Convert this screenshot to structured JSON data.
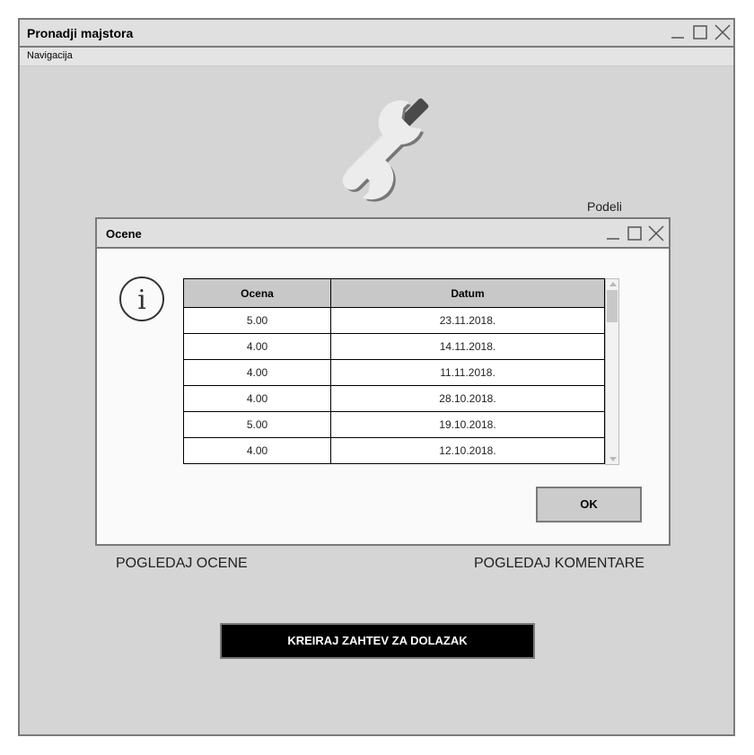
{
  "window": {
    "title": "Pronadji majstora",
    "controls": [
      "minimize-icon",
      "maximize-icon",
      "close-icon"
    ]
  },
  "menu": {
    "items": [
      "Navigacija"
    ]
  },
  "logo": {
    "icon": "wrench-screwdriver-icon"
  },
  "share_label": "Podeli",
  "dialog": {
    "title": "Ocene",
    "controls": [
      "minimize-icon",
      "maximize-icon",
      "close-icon"
    ],
    "icon": "info-icon",
    "table": {
      "headers": [
        "Ocena",
        "Datum"
      ],
      "rows": [
        [
          "5.00",
          "23.11.2018."
        ],
        [
          "4.00",
          "14.11.2018."
        ],
        [
          "4.00",
          "11.11.2018."
        ],
        [
          "4.00",
          "28.10.2018."
        ],
        [
          "5.00",
          "19.10.2018."
        ],
        [
          "4.00",
          "12.10.2018."
        ]
      ]
    },
    "ok_label": "OK"
  },
  "links": {
    "ratings": "POGLEDAJ OCENE",
    "comments": "POGLEDAJ KOMENTARE"
  },
  "cta": {
    "label": "KREIRAJ ZAHTEV ZA DOLAZAK"
  },
  "colors": {
    "background": "#d5d5d5",
    "dialog_bg": "#fafafa",
    "header_bg": "#c8c8c8",
    "cta_bg": "#000000"
  }
}
